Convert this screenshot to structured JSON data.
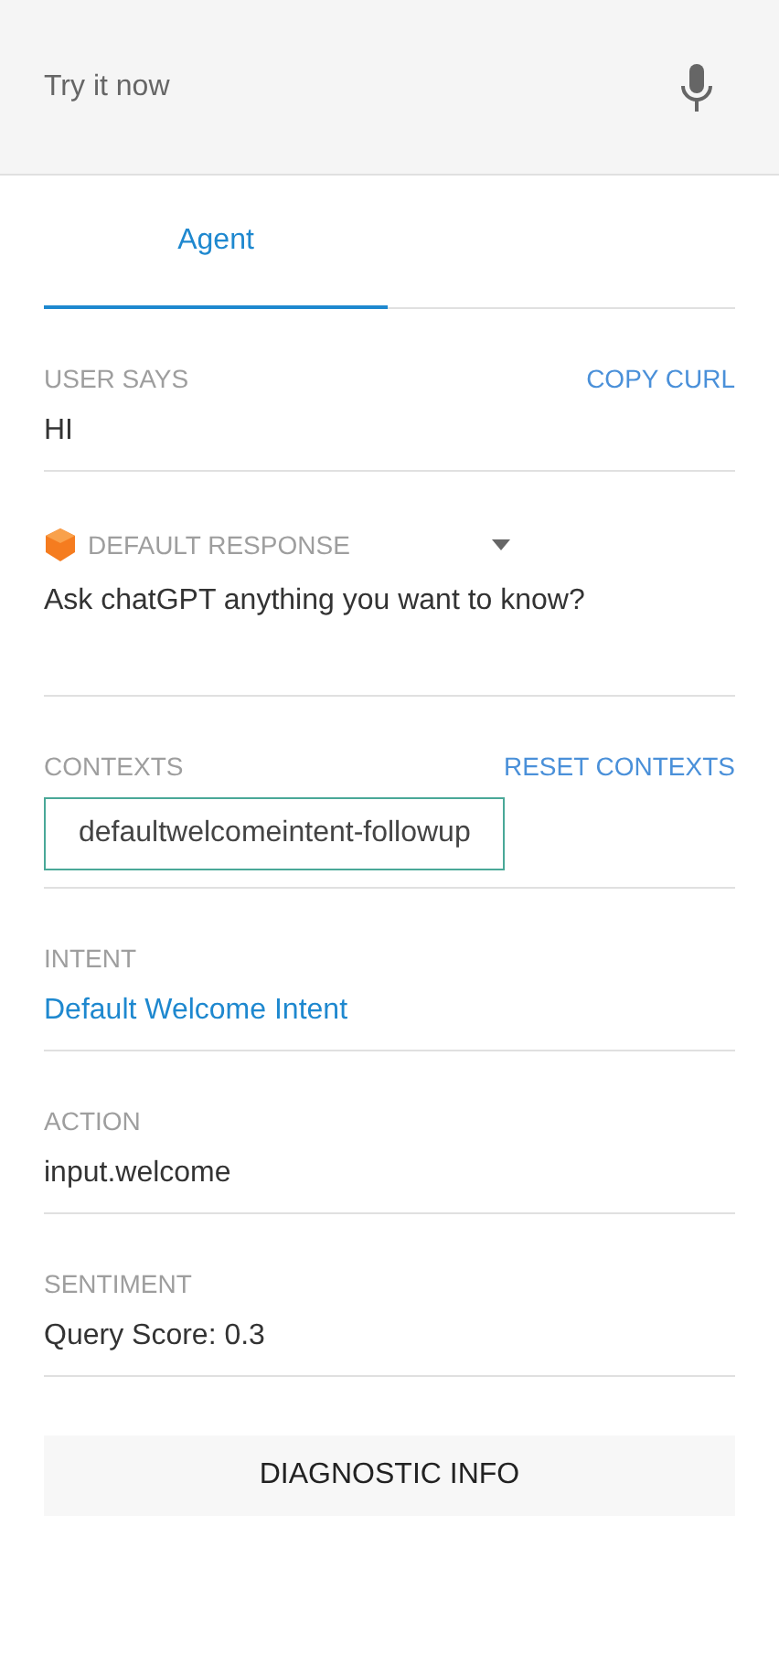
{
  "query": {
    "placeholder": "Try it now"
  },
  "tabs": [
    {
      "label": "Agent",
      "selected": true
    }
  ],
  "sections": [
    {
      "kind": "text",
      "label": "USER SAYS",
      "action": "COPY CURL",
      "value": "HI"
    },
    {
      "kind": "response",
      "label": "DEFAULT RESPONSE",
      "value": "Ask chatGPT anything you want to know?"
    },
    {
      "kind": "chips",
      "label": "CONTEXTS",
      "action": "RESET CONTEXTS",
      "chips": [
        "defaultwelcomeintent-followup"
      ]
    },
    {
      "kind": "link",
      "label": "INTENT",
      "value": "Default Welcome Intent"
    },
    {
      "kind": "text",
      "label": "ACTION",
      "value": "input.welcome"
    },
    {
      "kind": "text",
      "label": "SENTIMENT",
      "value": "Query Score: 0.3"
    }
  ],
  "footer_button": "DIAGNOSTIC INFO"
}
